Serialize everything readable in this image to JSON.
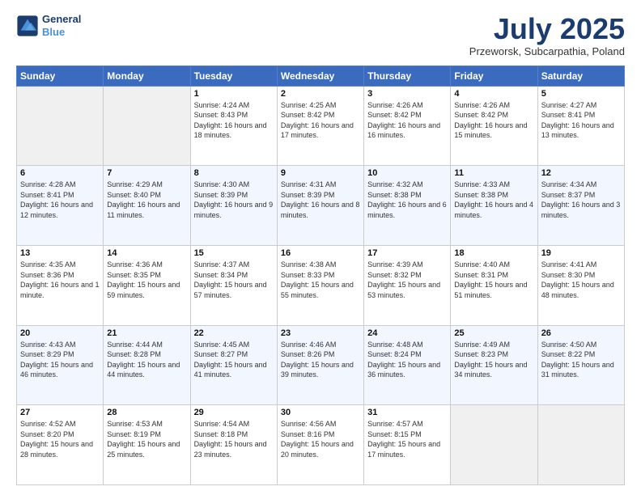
{
  "logo": {
    "line1": "General",
    "line2": "Blue"
  },
  "title": "July 2025",
  "subtitle": "Przeworsk, Subcarpathia, Poland",
  "headers": [
    "Sunday",
    "Monday",
    "Tuesday",
    "Wednesday",
    "Thursday",
    "Friday",
    "Saturday"
  ],
  "weeks": [
    [
      {
        "day": "",
        "info": ""
      },
      {
        "day": "",
        "info": ""
      },
      {
        "day": "1",
        "info": "Sunrise: 4:24 AM\nSunset: 8:43 PM\nDaylight: 16 hours and 18 minutes."
      },
      {
        "day": "2",
        "info": "Sunrise: 4:25 AM\nSunset: 8:42 PM\nDaylight: 16 hours and 17 minutes."
      },
      {
        "day": "3",
        "info": "Sunrise: 4:26 AM\nSunset: 8:42 PM\nDaylight: 16 hours and 16 minutes."
      },
      {
        "day": "4",
        "info": "Sunrise: 4:26 AM\nSunset: 8:42 PM\nDaylight: 16 hours and 15 minutes."
      },
      {
        "day": "5",
        "info": "Sunrise: 4:27 AM\nSunset: 8:41 PM\nDaylight: 16 hours and 13 minutes."
      }
    ],
    [
      {
        "day": "6",
        "info": "Sunrise: 4:28 AM\nSunset: 8:41 PM\nDaylight: 16 hours and 12 minutes."
      },
      {
        "day": "7",
        "info": "Sunrise: 4:29 AM\nSunset: 8:40 PM\nDaylight: 16 hours and 11 minutes."
      },
      {
        "day": "8",
        "info": "Sunrise: 4:30 AM\nSunset: 8:39 PM\nDaylight: 16 hours and 9 minutes."
      },
      {
        "day": "9",
        "info": "Sunrise: 4:31 AM\nSunset: 8:39 PM\nDaylight: 16 hours and 8 minutes."
      },
      {
        "day": "10",
        "info": "Sunrise: 4:32 AM\nSunset: 8:38 PM\nDaylight: 16 hours and 6 minutes."
      },
      {
        "day": "11",
        "info": "Sunrise: 4:33 AM\nSunset: 8:38 PM\nDaylight: 16 hours and 4 minutes."
      },
      {
        "day": "12",
        "info": "Sunrise: 4:34 AM\nSunset: 8:37 PM\nDaylight: 16 hours and 3 minutes."
      }
    ],
    [
      {
        "day": "13",
        "info": "Sunrise: 4:35 AM\nSunset: 8:36 PM\nDaylight: 16 hours and 1 minute."
      },
      {
        "day": "14",
        "info": "Sunrise: 4:36 AM\nSunset: 8:35 PM\nDaylight: 15 hours and 59 minutes."
      },
      {
        "day": "15",
        "info": "Sunrise: 4:37 AM\nSunset: 8:34 PM\nDaylight: 15 hours and 57 minutes."
      },
      {
        "day": "16",
        "info": "Sunrise: 4:38 AM\nSunset: 8:33 PM\nDaylight: 15 hours and 55 minutes."
      },
      {
        "day": "17",
        "info": "Sunrise: 4:39 AM\nSunset: 8:32 PM\nDaylight: 15 hours and 53 minutes."
      },
      {
        "day": "18",
        "info": "Sunrise: 4:40 AM\nSunset: 8:31 PM\nDaylight: 15 hours and 51 minutes."
      },
      {
        "day": "19",
        "info": "Sunrise: 4:41 AM\nSunset: 8:30 PM\nDaylight: 15 hours and 48 minutes."
      }
    ],
    [
      {
        "day": "20",
        "info": "Sunrise: 4:43 AM\nSunset: 8:29 PM\nDaylight: 15 hours and 46 minutes."
      },
      {
        "day": "21",
        "info": "Sunrise: 4:44 AM\nSunset: 8:28 PM\nDaylight: 15 hours and 44 minutes."
      },
      {
        "day": "22",
        "info": "Sunrise: 4:45 AM\nSunset: 8:27 PM\nDaylight: 15 hours and 41 minutes."
      },
      {
        "day": "23",
        "info": "Sunrise: 4:46 AM\nSunset: 8:26 PM\nDaylight: 15 hours and 39 minutes."
      },
      {
        "day": "24",
        "info": "Sunrise: 4:48 AM\nSunset: 8:24 PM\nDaylight: 15 hours and 36 minutes."
      },
      {
        "day": "25",
        "info": "Sunrise: 4:49 AM\nSunset: 8:23 PM\nDaylight: 15 hours and 34 minutes."
      },
      {
        "day": "26",
        "info": "Sunrise: 4:50 AM\nSunset: 8:22 PM\nDaylight: 15 hours and 31 minutes."
      }
    ],
    [
      {
        "day": "27",
        "info": "Sunrise: 4:52 AM\nSunset: 8:20 PM\nDaylight: 15 hours and 28 minutes."
      },
      {
        "day": "28",
        "info": "Sunrise: 4:53 AM\nSunset: 8:19 PM\nDaylight: 15 hours and 25 minutes."
      },
      {
        "day": "29",
        "info": "Sunrise: 4:54 AM\nSunset: 8:18 PM\nDaylight: 15 hours and 23 minutes."
      },
      {
        "day": "30",
        "info": "Sunrise: 4:56 AM\nSunset: 8:16 PM\nDaylight: 15 hours and 20 minutes."
      },
      {
        "day": "31",
        "info": "Sunrise: 4:57 AM\nSunset: 8:15 PM\nDaylight: 15 hours and 17 minutes."
      },
      {
        "day": "",
        "info": ""
      },
      {
        "day": "",
        "info": ""
      }
    ]
  ]
}
